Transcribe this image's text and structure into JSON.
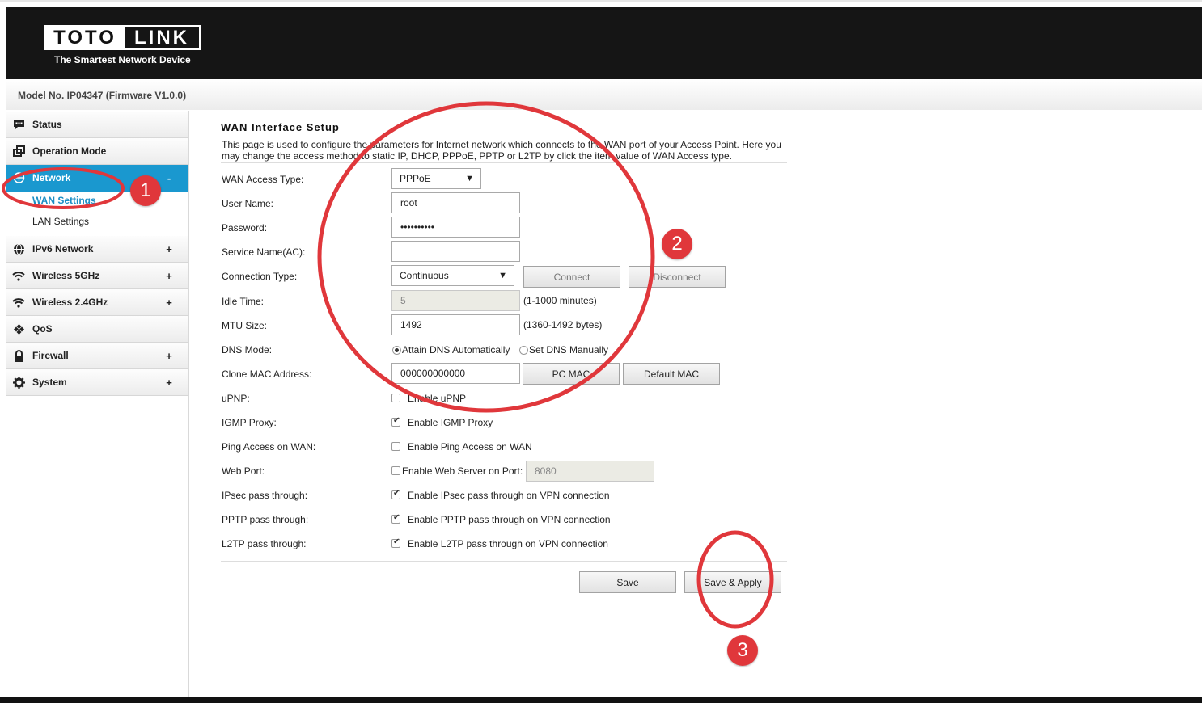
{
  "brand": {
    "logo_left": "TOTO",
    "logo_right": "LINK",
    "tagline": "The Smartest Network Device"
  },
  "model_info": "Model No. IP04347 (Firmware V1.0.0)",
  "sidebar": {
    "items": [
      {
        "label": "Status",
        "icon": "status-icon",
        "expander": ""
      },
      {
        "label": "Operation Mode",
        "icon": "operation-mode-icon",
        "expander": ""
      },
      {
        "label": "Network",
        "icon": "network-icon",
        "expander": "-"
      },
      {
        "label": "IPv6 Network",
        "icon": "globe-icon",
        "expander": "+"
      },
      {
        "label": "Wireless 5GHz",
        "icon": "wifi-icon",
        "expander": "+"
      },
      {
        "label": "Wireless 2.4GHz",
        "icon": "wifi-icon",
        "expander": "+"
      },
      {
        "label": "QoS",
        "icon": "qos-icon",
        "expander": ""
      },
      {
        "label": "Firewall",
        "icon": "lock-icon",
        "expander": "+"
      },
      {
        "label": "System",
        "icon": "gear-icon",
        "expander": "+"
      }
    ],
    "network_sub": [
      {
        "label": "WAN Settings",
        "current": true
      },
      {
        "label": "LAN Settings",
        "current": false
      }
    ]
  },
  "page": {
    "title": "WAN Interface Setup",
    "description": "This page is used to configure the parameters for Internet network which connects to the WAN port of your Access Point. Here you may change the access method to static IP, DHCP, PPPoE, PPTP or L2TP by click the item value of WAN Access type."
  },
  "form": {
    "wan_access_type": {
      "label": "WAN Access Type:",
      "value": "PPPoE"
    },
    "user_name": {
      "label": "User Name:",
      "value": "root"
    },
    "password": {
      "label": "Password:",
      "value": "••••••••••"
    },
    "service_name": {
      "label": "Service Name(AC):",
      "value": ""
    },
    "connection_type": {
      "label": "Connection Type:",
      "value": "Continuous",
      "connect": "Connect",
      "disconnect": "Disconnect"
    },
    "idle_time": {
      "label": "Idle Time:",
      "value": "5",
      "hint": "(1-1000 minutes)"
    },
    "mtu_size": {
      "label": "MTU Size:",
      "value": "1492",
      "hint": "(1360-1492 bytes)"
    },
    "dns_mode": {
      "label": "DNS Mode:",
      "option1": "Attain DNS Automatically",
      "option2": "Set DNS Manually",
      "selected": "option1"
    },
    "clone_mac": {
      "label": "Clone MAC Address:",
      "value": "000000000000",
      "pc_mac": "PC MAC",
      "default_mac": "Default MAC"
    },
    "upnp": {
      "label": "uPNP:",
      "option": "Enable uPNP",
      "checked": false
    },
    "igmp_proxy": {
      "label": "IGMP Proxy:",
      "option": "Enable IGMP Proxy",
      "checked": true
    },
    "ping_access": {
      "label": "Ping Access on WAN:",
      "option": "Enable Ping Access on WAN",
      "checked": false
    },
    "web_port": {
      "label": "Web Port:",
      "option": "Enable Web Server on Port:",
      "value": "8080",
      "checked": false
    },
    "ipsec": {
      "label": "IPsec pass through:",
      "option": "Enable IPsec pass through on VPN connection",
      "checked": true
    },
    "pptp": {
      "label": "PPTP pass through:",
      "option": "Enable PPTP pass through on VPN connection",
      "checked": true
    },
    "l2tp": {
      "label": "L2TP pass through:",
      "option": "Enable L2TP pass through on VPN connection",
      "checked": true
    }
  },
  "actions": {
    "save": "Save",
    "save_apply": "Save & Apply"
  },
  "annotations": {
    "marker1": "1",
    "marker2": "2",
    "marker3": "3",
    "color": "#e0373b"
  },
  "colors": {
    "header": "#151515",
    "accent": "#1a98cf"
  }
}
